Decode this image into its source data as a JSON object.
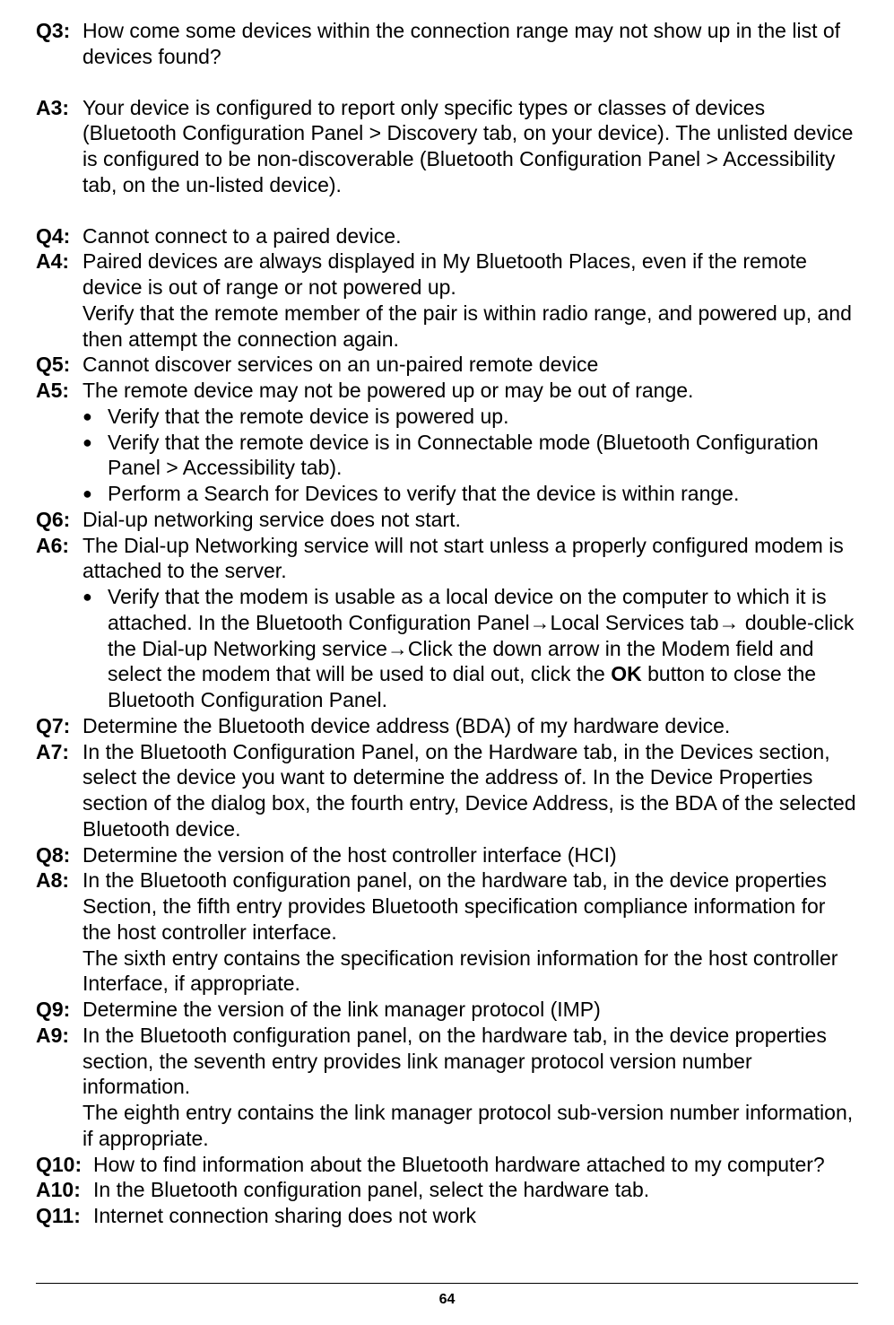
{
  "q3_label": "Q3:",
  "q3_text": "How come some devices within the connection range may not show up in the list of devices found?",
  "a3_label": "A3:",
  "a3_text": "Your device is configured to report only specific types or classes of devices (Bluetooth Configuration Panel > Discovery tab, on your device). The unlisted device is configured to be non-discoverable (Bluetooth Configuration Panel > Accessibility tab, on the un-listed device).",
  "q4_label": "Q4:",
  "q4_text": "Cannot connect to a paired device.",
  "a4_label": "A4:",
  "a4_p1": "Paired devices are always displayed in My Bluetooth Places, even if the remote device is out of range or not powered up.",
  "a4_p2": "Verify that the remote member of the pair is within radio range, and powered up, and then attempt the connection again.",
  "q5_label": "Q5:",
  "q5_text": "Cannot discover services on an un-paired remote device",
  "a5_label": "A5:",
  "a5_intro": "The remote device may not be powered up or may be out of range.",
  "a5_b1": "Verify that the remote device is powered up.",
  "a5_b2": "Verify that the remote device is in Connectable mode (Bluetooth Configuration Panel > Accessibility tab).",
  "a5_b3": "Perform a Search for Devices to verify that the device is within range.",
  "q6_label": "Q6:",
  "q6_text": "Dial-up networking service does not start.",
  "a6_label": "A6:",
  "a6_intro": "The Dial-up Networking service will not start unless a properly configured modem is attached to the server.",
  "a6_b1_pre": "Verify that the modem is usable as a local device on the computer to which it is attached. In the Bluetooth Configuration Panel→Local Services tab→ double-click the Dial-up Networking service→Click the down arrow in the Modem field and select the modem that will be used to dial out, click the ",
  "a6_b1_bold": "OK",
  "a6_b1_post": " button to close the Bluetooth Configuration Panel.",
  "q7_label": "Q7:",
  "q7_text": "Determine the Bluetooth device address (BDA) of my hardware device.",
  "a7_label": "A7:",
  "a7_text": "In the Bluetooth Configuration Panel, on the Hardware tab, in the Devices section, select the device you want to determine the address of. In the Device Properties section of the dialog box, the fourth entry, Device Address, is the BDA of the selected Bluetooth device.",
  "q8_label": "Q8:",
  "q8_text": "Determine the version of the host controller interface (HCI)",
  "a8_label": "A8:",
  "a8_p1": "In the Bluetooth configuration panel, on the hardware tab, in the device properties Section, the fifth entry provides Bluetooth specification compliance information for the host controller interface.",
  "a8_p2": "The sixth entry contains the specification revision information for the host controller Interface, if appropriate.",
  "q9_label": "Q9:",
  "q9_text": "Determine the version of the link manager protocol (IMP)",
  "a9_label": "A9:",
  "a9_p1": "In the Bluetooth configuration panel, on the hardware tab, in the device properties section, the seventh entry provides link manager protocol version number information.",
  "a9_p2": "The eighth entry contains the link manager protocol sub-version number information, if appropriate.",
  "q10_label": "Q10:",
  "q10_text": "How to find information about the Bluetooth hardware attached to my computer?",
  "a10_label": "A10:",
  "a10_text": "In the Bluetooth configuration panel, select the hardware tab.",
  "q11_label": "Q11:",
  "q11_text": "Internet connection sharing does not work",
  "page_number": "64"
}
